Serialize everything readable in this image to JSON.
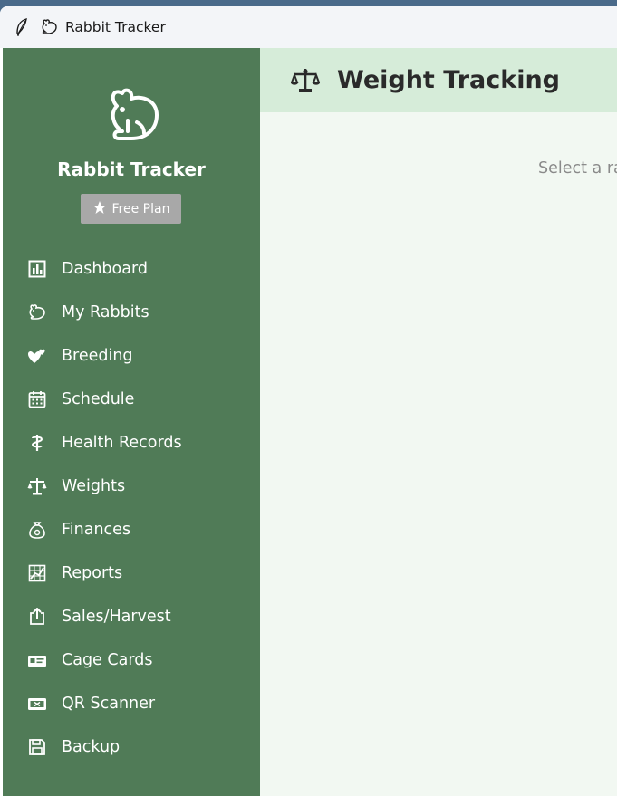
{
  "window": {
    "title": "Rabbit Tracker"
  },
  "sidebar": {
    "brand_name": "Rabbit Tracker",
    "plan_badge": "Free Plan",
    "items": [
      {
        "label": "Dashboard",
        "icon": "bar-chart-icon"
      },
      {
        "label": "My Rabbits",
        "icon": "rabbit-icon"
      },
      {
        "label": "Breeding",
        "icon": "hearts-icon"
      },
      {
        "label": "Schedule",
        "icon": "calendar-icon"
      },
      {
        "label": "Health Records",
        "icon": "medical-icon"
      },
      {
        "label": "Weights",
        "icon": "scale-icon"
      },
      {
        "label": "Finances",
        "icon": "money-bag-icon"
      },
      {
        "label": "Reports",
        "icon": "report-icon"
      },
      {
        "label": "Sales/Harvest",
        "icon": "export-icon"
      },
      {
        "label": "Cage Cards",
        "icon": "id-card-icon"
      },
      {
        "label": "QR Scanner",
        "icon": "scanner-icon"
      },
      {
        "label": "Backup",
        "icon": "floppy-disk-icon"
      }
    ]
  },
  "main": {
    "header_title": "Weight Tracking",
    "placeholder_text": "Select a ra"
  },
  "colors": {
    "sidebar_bg": "#507b57",
    "header_bg": "#d6ecd9",
    "main_bg": "#f2f8f2",
    "badge_bg": "#a8a8a8"
  }
}
